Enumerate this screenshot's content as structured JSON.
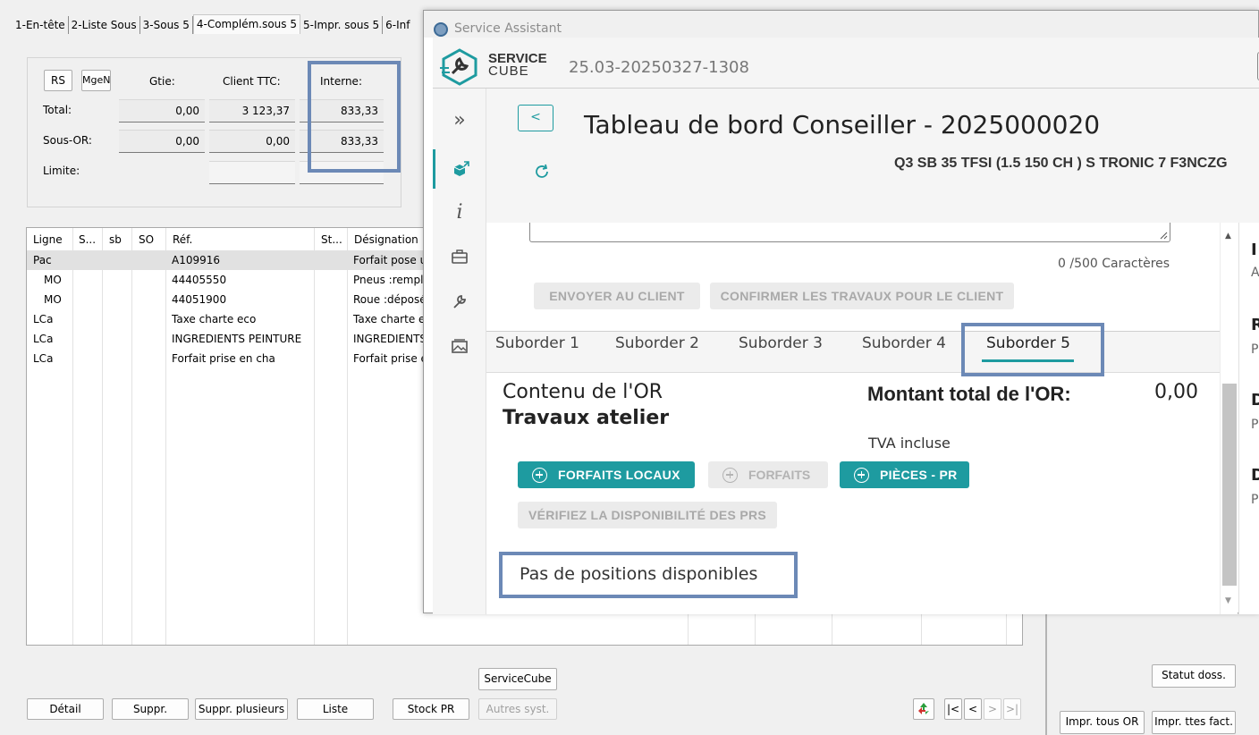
{
  "legacy": {
    "tabs": [
      "1-En-tête",
      "2-Liste Sous",
      "3-Sous 5",
      "4-Complém.sous 5",
      "5-Impr. sous 5",
      "6-Inf"
    ],
    "totals": {
      "rs_label": "RS",
      "mgen_label": "MgeN",
      "col_gtie": "Gtie:",
      "col_client": "Client TTC:",
      "col_interne": "Interne:",
      "row_total": "Total:",
      "row_sous_or": "Sous-OR:",
      "row_limite": "Limite:",
      "total_gtie": "0,00",
      "total_client": "3 123,37",
      "total_interne": "833,33",
      "sous_gtie": "0,00",
      "sous_client": "0,00",
      "sous_interne": "833,33"
    },
    "grid": {
      "headers": [
        "Ligne",
        "S...",
        "sb",
        "SO",
        "Réf.",
        "St...",
        "Désignation"
      ],
      "rows": [
        {
          "ligne": "Pac",
          "ref": "A109916",
          "des": "Forfait pose u"
        },
        {
          "ligne": "MO",
          "ref": "44405550",
          "des": "Pneus :rempla"
        },
        {
          "ligne": "MO",
          "ref": "44051900",
          "des": "Roue :déposé"
        },
        {
          "ligne": "LCa",
          "ref": "Taxe charte eco",
          "des": "Taxe charte e"
        },
        {
          "ligne": "LCa",
          "ref": "INGREDIENTS PEINTURE",
          "des": "INGREDIENTS"
        },
        {
          "ligne": "LCa",
          "ref": "Forfait prise en cha",
          "des": "Forfait prise e"
        }
      ]
    },
    "buttons": {
      "servicecube": "ServiceCube",
      "detail": "Détail",
      "suppr": "Suppr.",
      "suppr_plusieurs": "Suppr. plusieurs",
      "liste": "Liste",
      "stock_pr": "Stock PR",
      "autres_syst": "Autres syst.",
      "statut": "Statut doss.",
      "impr_tous_or": "Impr. tous OR",
      "impr_ttes_fact": "Impr. ttes fact."
    },
    "nav": {
      "first": "|<",
      "prev": "<",
      "next": ">",
      "last": ">|"
    }
  },
  "assistant": {
    "window_title": "Service Assistant",
    "logo_line1": "SERVICE",
    "logo_line2": "CUBE",
    "version": "25.03-20250327-1308",
    "page_title": "Tableau de bord Conseiller - 2025000020",
    "vehicle": "Q3 SB 35 TFSI (1.5 150 CH ) S TRONIC 7 F3NCZG",
    "back_label": "<",
    "char_count": "0 /500 Caractères",
    "btn_send": "ENVOYER AU CLIENT",
    "btn_confirm": "CONFIRMER LES TRAVAUX POUR LE CLIENT",
    "suborders": [
      "Suborder 1",
      "Suborder 2",
      "Suborder 3",
      "Suborder 4",
      "Suborder 5"
    ],
    "active_suborder": "Suborder 5",
    "contenu_label": "Contenu de l'OR",
    "travaux_label": "Travaux atelier",
    "montant_label": "Montant total de l'OR:",
    "tva_label": "TVA incluse",
    "montant_value": "0,00",
    "btn_forfaits_locaux": "FORFAITS LOCAUX",
    "btn_forfaits": "FORFAITS",
    "btn_pieces": "PIÈCES - PR",
    "btn_verifiez": "VÉRIFIEZ LA DISPONIBILITÉ DES PRS",
    "empty_message": "Pas de positions disponibles",
    "right_letters": [
      "I",
      "A",
      "R",
      "P",
      "D",
      "P",
      "D",
      "P"
    ],
    "colors": {
      "teal": "#1e9ba0",
      "highlight": "#6c89b6"
    }
  }
}
